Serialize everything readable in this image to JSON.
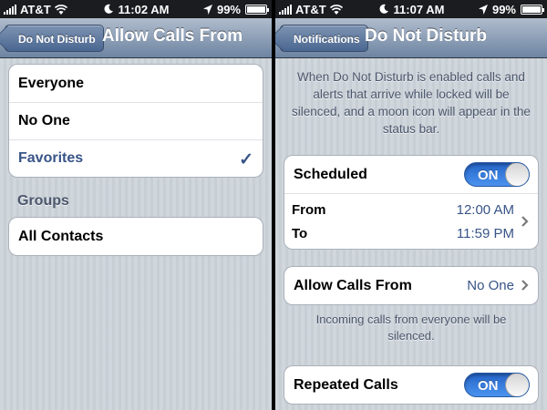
{
  "left": {
    "statusbar": {
      "carrier": "AT&T",
      "time": "11:02 AM",
      "battery": "99%"
    },
    "navbar": {
      "back_label": "Do Not Disturb",
      "title": "Allow Calls From"
    },
    "options": [
      {
        "label": "Everyone",
        "selected": false
      },
      {
        "label": "No One",
        "selected": false
      },
      {
        "label": "Favorites",
        "selected": true
      }
    ],
    "groups_header": "Groups",
    "groups": [
      {
        "label": "All Contacts"
      }
    ]
  },
  "right": {
    "statusbar": {
      "carrier": "AT&T",
      "time": "11:07 AM",
      "battery": "99%"
    },
    "navbar": {
      "back_label": "Notifications",
      "title": "Do Not Disturb"
    },
    "description": "When Do Not Disturb is enabled calls and alerts that arrive while locked will be silenced, and a moon icon will appear in the status bar.",
    "scheduled": {
      "label": "Scheduled",
      "toggle": "ON"
    },
    "from": {
      "label": "From",
      "value": "12:00 AM"
    },
    "to": {
      "label": "To",
      "value": "11:59 PM"
    },
    "allow_calls": {
      "label": "Allow Calls From",
      "value": "No One"
    },
    "allow_calls_footer": "Incoming calls from everyone will be silenced.",
    "repeated": {
      "label": "Repeated Calls",
      "toggle": "ON"
    }
  },
  "icons": {
    "signal": "signal-bars-icon",
    "wifi": "wifi-icon",
    "moon": "moon-icon",
    "location": "location-arrow-icon",
    "battery": "battery-icon",
    "check": "checkmark-icon",
    "chevron": "chevron-right-icon"
  },
  "colors": {
    "accent": "#385487",
    "toggle_on": "#2f76db",
    "nav_top": "#b0bccd",
    "nav_bottom": "#6d84a2"
  }
}
